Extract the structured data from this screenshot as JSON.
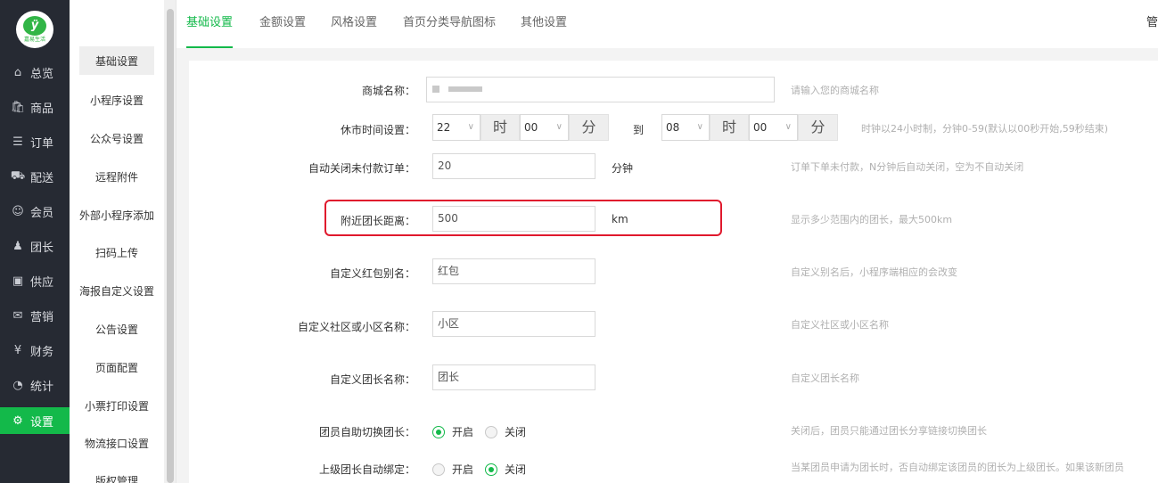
{
  "brand": {
    "logo_mark": "ÿ",
    "logo_text": "嘉易生活"
  },
  "nav": [
    {
      "icon": "⌂",
      "label": "总览"
    },
    {
      "icon": "🛍",
      "label": "商品"
    },
    {
      "icon": "☰",
      "label": "订单"
    },
    {
      "icon": "⛟",
      "label": "配送"
    },
    {
      "icon": "☺",
      "label": "会员"
    },
    {
      "icon": "♟",
      "label": "团长"
    },
    {
      "icon": "▣",
      "label": "供应"
    },
    {
      "icon": "✉",
      "label": "营销"
    },
    {
      "icon": "¥",
      "label": "财务"
    },
    {
      "icon": "◔",
      "label": "统计"
    },
    {
      "icon": "⚙",
      "label": "设置"
    }
  ],
  "subnav": [
    "基础设置",
    "小程序设置",
    "公众号设置",
    "远程附件",
    "外部小程序添加",
    "扫码上传",
    "海报自定义设置",
    "公告设置",
    "页面配置",
    "小票打印设置",
    "物流接口设置",
    "版权管理"
  ],
  "tabs": [
    "基础设置",
    "金额设置",
    "风格设置",
    "首页分类导航图标",
    "其他设置"
  ],
  "admin_label": "管",
  "form": {
    "shop_name": {
      "label": "商城名称：",
      "help": "请输入您的商城名称"
    },
    "closing_time": {
      "label": "休市时间设置：",
      "start_hour": "22",
      "start_min": "00",
      "end_hour": "08",
      "end_min": "00",
      "hour_addon": "时",
      "min_addon": "分",
      "to": "到",
      "help": "时钟以24小时制，分钟0-59(默认以00秒开始,59秒结束)"
    },
    "auto_close": {
      "label": "自动关闭未付款订单：",
      "value": "20",
      "unit": "分钟",
      "help": "订单下单未付款，N分钟后自动关闭，空为不自动关闭"
    },
    "nearby_distance": {
      "label": "附近团长距离：",
      "value": "500",
      "unit": "km",
      "help": "显示多少范围内的团长，最大500km"
    },
    "red_packet_alias": {
      "label": "自定义红包别名：",
      "value": "红包",
      "help": "自定义别名后，小程序端相应的会改变"
    },
    "community_name": {
      "label": "自定义社区或小区名称：",
      "value": "小区",
      "help": "自定义社区或小区名称"
    },
    "leader_name": {
      "label": "自定义团长名称：",
      "value": "团长",
      "help": "自定义团长名称"
    },
    "self_switch": {
      "label": "团员自助切换团长：",
      "on": "开启",
      "off": "关闭",
      "selected": "on",
      "help": "关闭后，团员只能通过团长分享链接切换团长"
    },
    "auto_bind": {
      "label": "上级团长自动绑定：",
      "on": "开启",
      "off": "关闭",
      "selected": "off",
      "help": "当某团员申请为团长时，否自动绑定该团员的团长为上级团长。如果该新团员"
    }
  },
  "colors": {
    "accent": "#13b94a",
    "nav_bg": "#262a33",
    "highlight": "#e0192d"
  }
}
